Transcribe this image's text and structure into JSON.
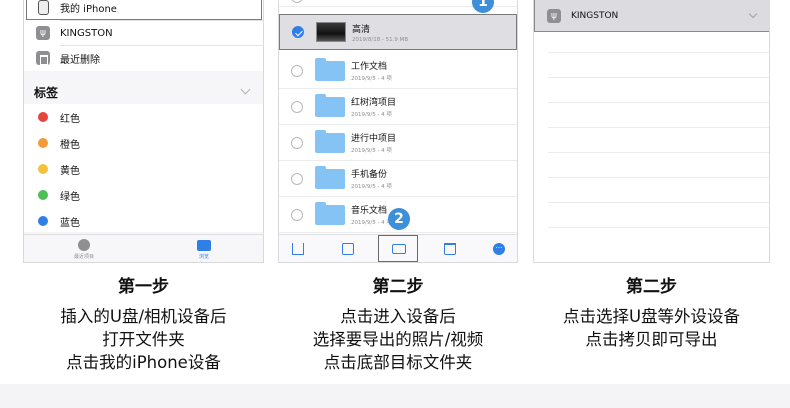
{
  "panel1": {
    "locations": [
      {
        "label": "我的 iPhone",
        "icon": "phone-icon"
      },
      {
        "label": "KINGSTON",
        "icon": "usb-drive-icon"
      },
      {
        "label": "最近删除",
        "icon": "trash-icon"
      }
    ],
    "tags_header": "标签",
    "tags": [
      {
        "label": "红色",
        "color": "#e5453a"
      },
      {
        "label": "橙色",
        "color": "#f29a38"
      },
      {
        "label": "黄色",
        "color": "#f3c23c"
      },
      {
        "label": "绿色",
        "color": "#4cbf55"
      },
      {
        "label": "蓝色",
        "color": "#2f7fe6"
      }
    ],
    "tabs": [
      {
        "label": "最近项目",
        "icon": "clock-icon"
      },
      {
        "label": "浏览",
        "icon": "folder-icon"
      }
    ]
  },
  "panel2": {
    "files": [
      {
        "name": "高清",
        "meta": "2019/8/18 - 51.9 MB",
        "type": "video",
        "selected": true
      },
      {
        "name": "工作文档",
        "meta": "2019/9/5 - 4 项",
        "type": "folder",
        "selected": false
      },
      {
        "name": "红树湾项目",
        "meta": "2019/9/5 - 4 项",
        "type": "folder",
        "selected": false
      },
      {
        "name": "进行中项目",
        "meta": "2019/9/5 - 4 项",
        "type": "folder",
        "selected": false
      },
      {
        "name": "手机备份",
        "meta": "2019/9/5 - 4 项",
        "type": "folder",
        "selected": false
      },
      {
        "name": "音乐文档",
        "meta": "2019/9/5 - 4 项",
        "type": "folder",
        "selected": false
      }
    ],
    "badge_top": "1",
    "badge_bottom": "2",
    "toolbar_icons": [
      "share-icon",
      "duplicate-icon",
      "move-folder-icon",
      "trash-icon",
      "more-icon"
    ]
  },
  "panel3": {
    "location": "KINGSTON"
  },
  "captions": [
    {
      "title": "第一步",
      "lines": [
        "插入的U盘/相机设备后",
        "打开文件夹",
        "点击我的iPhone设备"
      ]
    },
    {
      "title": "第二步",
      "lines": [
        "点击进入设备后",
        "选择要导出的照片/视频",
        "点击底部目标文件夹"
      ]
    },
    {
      "title": "第二步",
      "lines": [
        "点击选择U盘等外设设备",
        "点击拷贝即可导出"
      ]
    }
  ],
  "colors": {
    "accent": "#2f7fe6",
    "badge": "#3d8fd9"
  }
}
